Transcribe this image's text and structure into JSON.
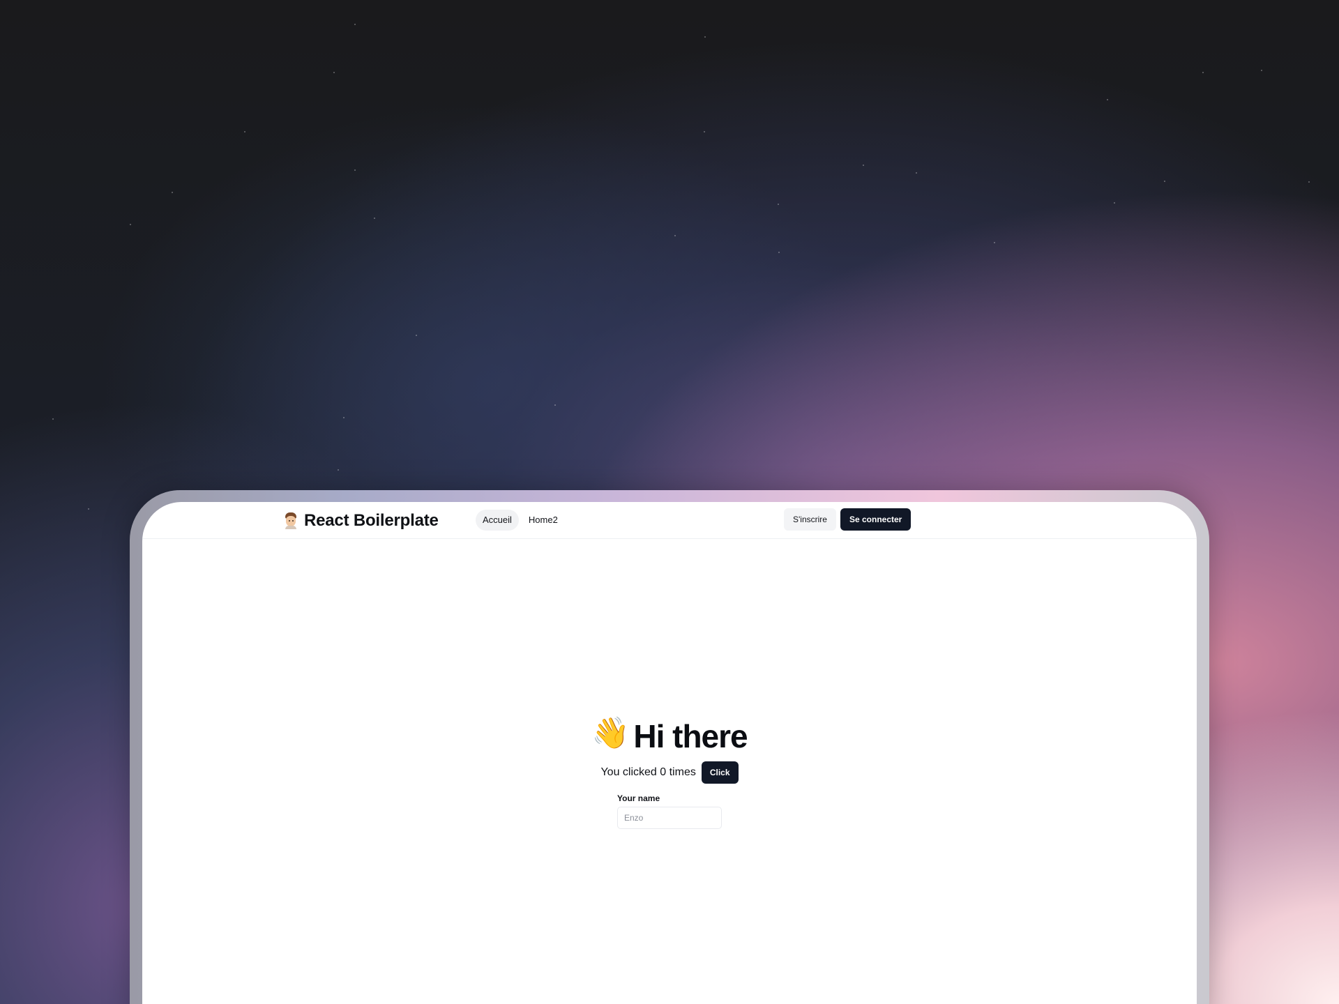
{
  "brand": {
    "icon": "person-avatar-icon",
    "title": "React Boilerplate"
  },
  "nav": {
    "links": [
      {
        "label": "Accueil",
        "active": true
      },
      {
        "label": "Home2",
        "active": false
      }
    ]
  },
  "actions": {
    "signup_label": "S'inscrire",
    "login_label": "Se connecter"
  },
  "hero": {
    "icon": "waving-hand-icon",
    "emoji": "👋",
    "title": "Hi there"
  },
  "counter": {
    "text": "You clicked 0 times",
    "button_label": "Click"
  },
  "form": {
    "name_label": "Your name",
    "name_placeholder": "Enzo",
    "name_value": ""
  },
  "colors": {
    "primary": "#111827",
    "nav_active_bg": "#f1f2f4",
    "page_bg": "#ffffff"
  }
}
